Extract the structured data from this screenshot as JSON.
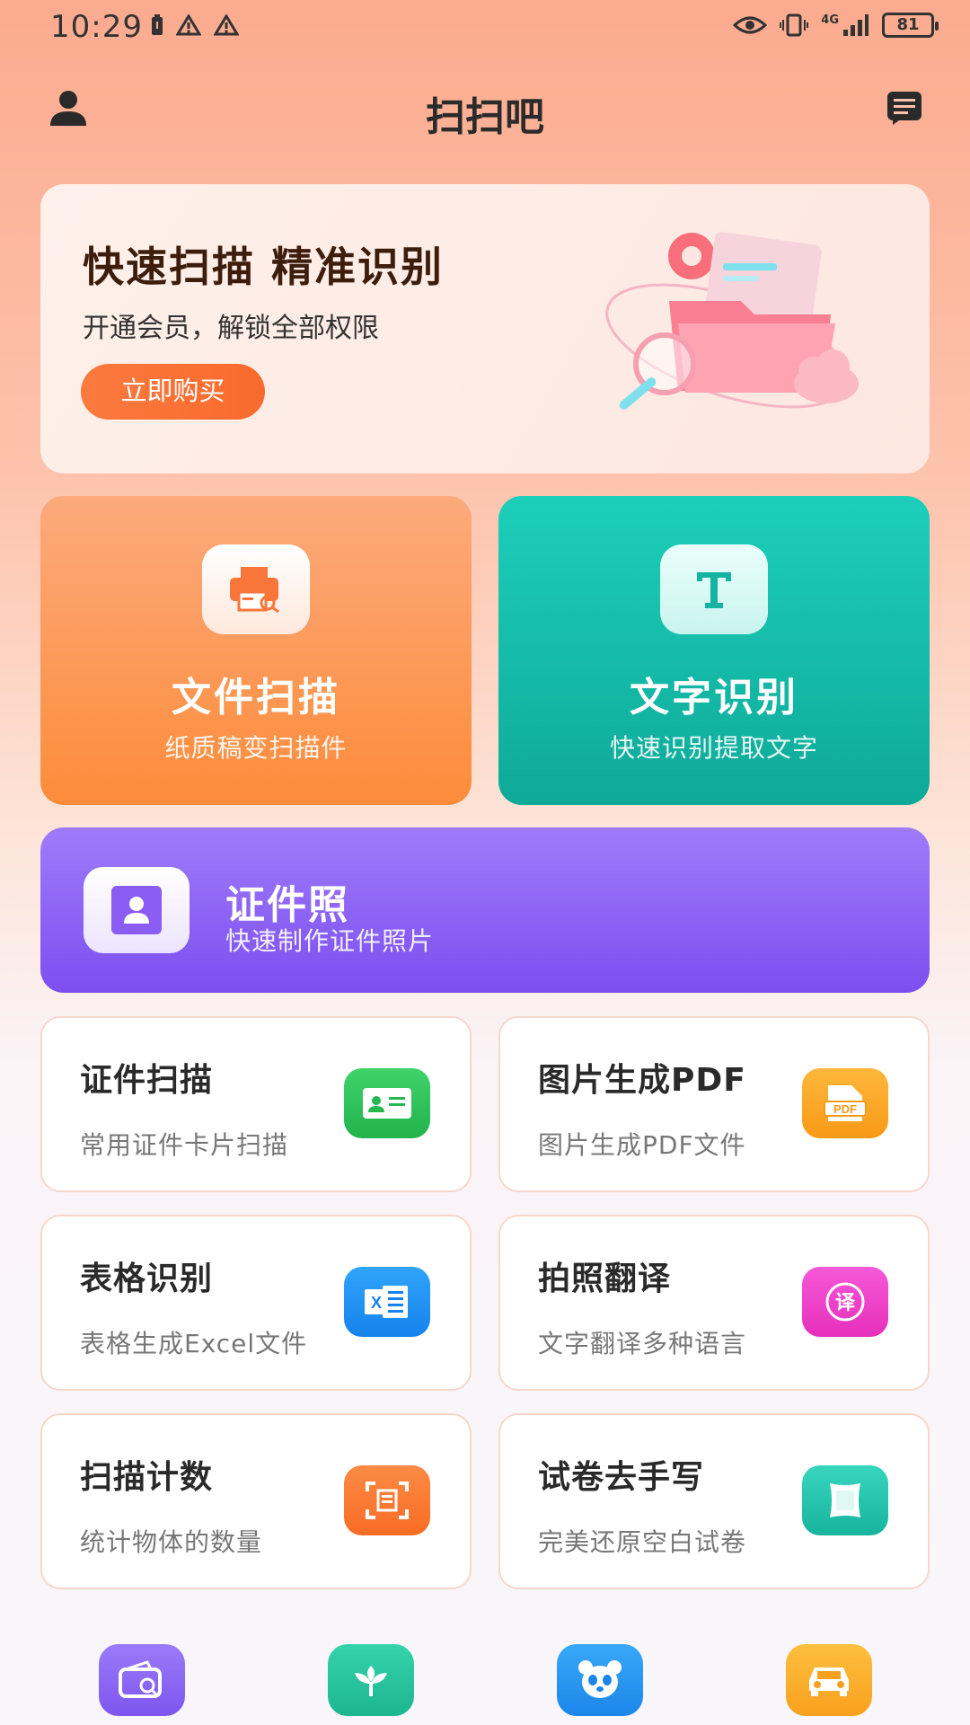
{
  "status_bar": {
    "time": "10:29",
    "battery": "81",
    "network": "4G"
  },
  "header": {
    "title": "扫扫吧"
  },
  "banner": {
    "title": "快速扫描 精准识别",
    "subtitle": "开通会员，解锁全部权限",
    "button_label": "立即购买"
  },
  "features": {
    "scan": {
      "title": "文件扫描",
      "subtitle": "纸质稿变扫描件",
      "icon": "printer-scan-icon"
    },
    "ocr": {
      "title": "文字识别",
      "subtitle": "快速识别提取文字",
      "icon": "text-t-icon"
    },
    "id_photo": {
      "title": "证件照",
      "subtitle": "快速制作证件照片",
      "icon": "id-photo-icon"
    }
  },
  "tools": [
    {
      "title": "证件扫描",
      "subtitle": "常用证件卡片扫描",
      "icon": "id-card-icon",
      "color": "#2fc25b"
    },
    {
      "title": "图片生成PDF",
      "subtitle": "图片生成PDF文件",
      "icon": "pdf-icon",
      "icon_text": "PDF",
      "color": "#fba324"
    },
    {
      "title": "表格识别",
      "subtitle": "表格生成Excel文件",
      "icon": "excel-icon",
      "icon_text": "X",
      "color": "#1e8ef5"
    },
    {
      "title": "拍照翻译",
      "subtitle": "文字翻译多种语言",
      "icon": "translate-icon",
      "icon_text": "译",
      "color": "#f03fc9"
    },
    {
      "title": "扫描计数",
      "subtitle": "统计物体的数量",
      "icon": "count-scan-icon",
      "color": "#fb7a33"
    },
    {
      "title": "试卷去手写",
      "subtitle": "完美还原空白试卷",
      "icon": "paper-clean-icon",
      "color": "#22c4ad"
    }
  ],
  "dock": [
    {
      "icon": "wallet-search-icon",
      "color": "#8b66f5"
    },
    {
      "icon": "plant-icon",
      "color": "#27c29c"
    },
    {
      "icon": "panda-icon",
      "color": "#2496ef"
    },
    {
      "icon": "car-icon",
      "color": "#fbab2c"
    }
  ]
}
